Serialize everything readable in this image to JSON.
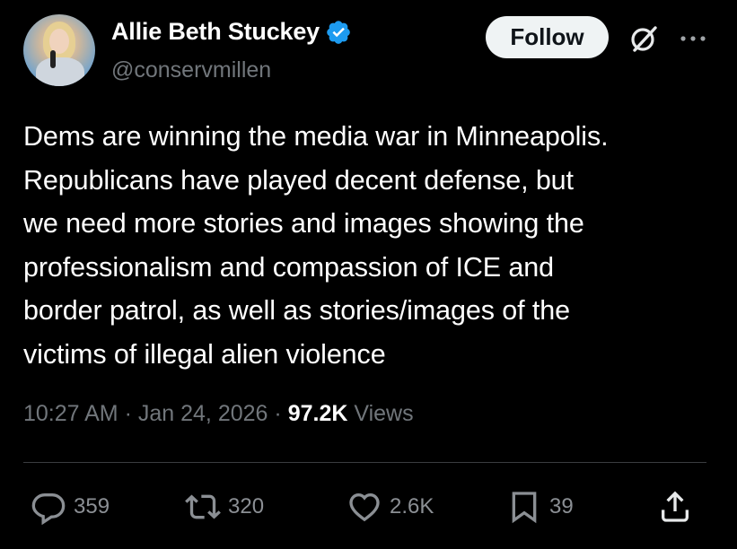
{
  "author": {
    "name": "Allie Beth Stuckey",
    "handle": "@conservmillen"
  },
  "follow_label": "Follow",
  "tweet": {
    "lines": [
      "Dems are winning the media war in Minneapolis.",
      "Republicans have played decent defense, but",
      "we need more stories and images showing the",
      "professionalism and compassion of ICE and",
      "border patrol, as well as stories/images of the",
      "victims of illegal alien violence"
    ]
  },
  "meta": {
    "time": "10:27 AM",
    "date": "Jan 24, 2026",
    "views_count": "97.2K",
    "views_label": "Views"
  },
  "actions": {
    "replies": "359",
    "reposts": "320",
    "likes": "2.6K",
    "bookmarks": "39"
  },
  "colors": {
    "background": "#000000",
    "text": "#ffffff",
    "muted": "#71767b",
    "verified": "#1d9bf0",
    "follow_bg": "#eff3f4"
  },
  "icons": [
    "verified-badge-icon",
    "grok-icon",
    "more-icon",
    "reply-icon",
    "repost-icon",
    "like-icon",
    "bookmark-icon",
    "share-icon"
  ]
}
